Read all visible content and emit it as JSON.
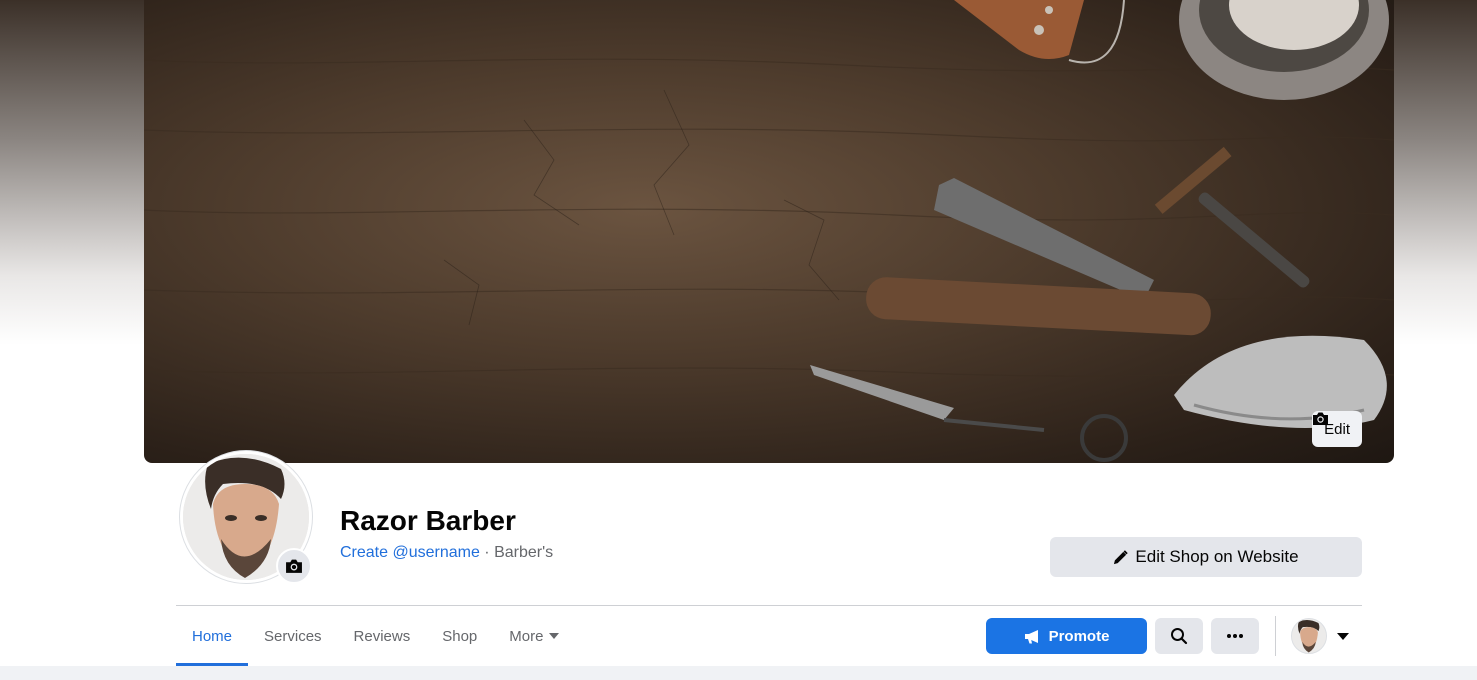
{
  "cover": {
    "edit_label": "Edit"
  },
  "page": {
    "name": "Razor Barber",
    "username_link": "Create @username",
    "separator": " · ",
    "category": "Barber's"
  },
  "actions": {
    "edit_shop_label": "Edit Shop on Website",
    "promote_label": "Promote"
  },
  "tabs": [
    {
      "label": "Home",
      "active": true
    },
    {
      "label": "Services",
      "active": false
    },
    {
      "label": "Reviews",
      "active": false
    },
    {
      "label": "Shop",
      "active": false
    },
    {
      "label": "More",
      "active": false
    }
  ],
  "colors": {
    "brand_blue": "#1b74e4",
    "link_blue": "#216fdb",
    "button_gray": "#e4e6eb"
  },
  "icons": {
    "cover_edit": "camera-icon",
    "avatar_edit": "camera-icon",
    "edit_shop": "pencil-icon",
    "promote": "megaphone-icon",
    "search": "search-icon",
    "more": "ellipsis-icon",
    "profile_switch": "caret-down-icon"
  }
}
